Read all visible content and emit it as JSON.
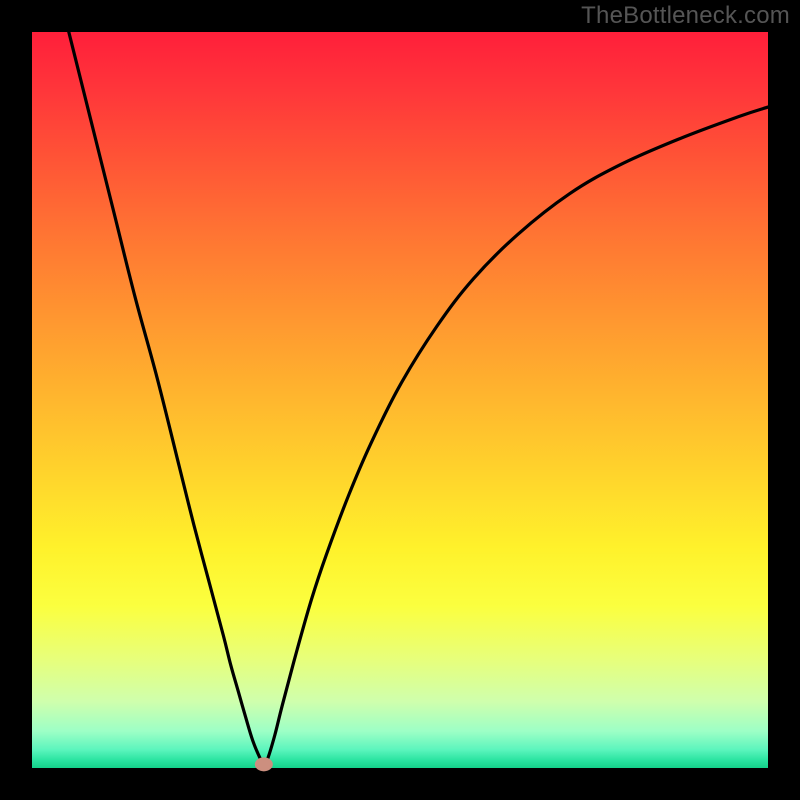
{
  "watermark": "TheBottleneck.com",
  "chart_data": {
    "type": "line",
    "title": "",
    "xlabel": "",
    "ylabel": "",
    "xlim": [
      0,
      100
    ],
    "ylim": [
      0,
      100
    ],
    "grid": false,
    "legend": false,
    "marker": {
      "x": 31.5,
      "y": 0.5,
      "color": "#cc8f7f"
    },
    "series": [
      {
        "name": "bottleneck-curve",
        "color": "#000000",
        "x": [
          5,
          8,
          11,
          14,
          17,
          20,
          22,
          24,
          26,
          27,
          28,
          29,
          30,
          31,
          31.5,
          32,
          33,
          34,
          36,
          38,
          40,
          43,
          46,
          50,
          55,
          60,
          66,
          73,
          80,
          88,
          96,
          100
        ],
        "y": [
          100,
          88,
          76,
          64,
          53,
          41,
          33,
          25.5,
          18,
          14,
          10.5,
          7,
          3.7,
          1.3,
          0.5,
          1.2,
          4.5,
          8.5,
          16,
          23,
          29,
          37,
          44,
          52,
          60,
          66.5,
          72.5,
          78,
          82,
          85.5,
          88.5,
          89.8
        ]
      }
    ],
    "background_gradient": {
      "direction": "top-to-bottom",
      "stops": [
        {
          "pos": 0.0,
          "color": "#ff1f3a"
        },
        {
          "pos": 0.35,
          "color": "#ff8e30"
        },
        {
          "pos": 0.7,
          "color": "#fff12b"
        },
        {
          "pos": 0.93,
          "color": "#cfffad"
        },
        {
          "pos": 1.0,
          "color": "#14d18a"
        }
      ]
    }
  }
}
